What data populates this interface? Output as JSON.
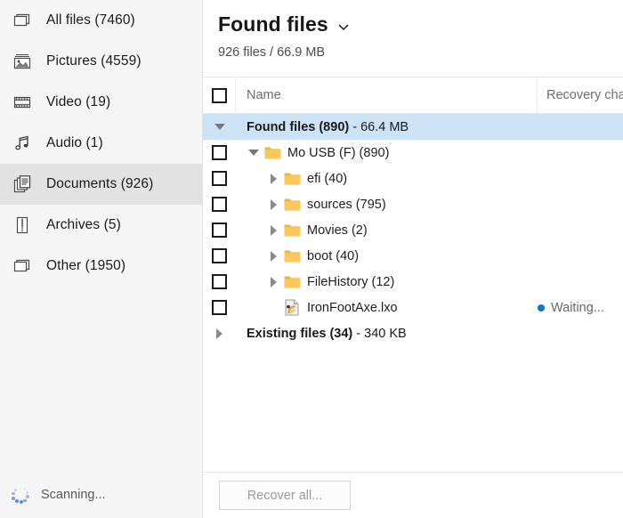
{
  "sidebar": {
    "items": [
      {
        "label": "All files (7460)",
        "icon": "window-icon",
        "selected": false
      },
      {
        "label": "Pictures (4559)",
        "icon": "picture-icon",
        "selected": false
      },
      {
        "label": "Video (19)",
        "icon": "film-icon",
        "selected": false
      },
      {
        "label": "Audio (1)",
        "icon": "music-note-icon",
        "selected": false
      },
      {
        "label": "Documents (926)",
        "icon": "documents-icon",
        "selected": true
      },
      {
        "label": "Archives (5)",
        "icon": "archive-icon",
        "selected": false
      },
      {
        "label": "Other (1950)",
        "icon": "window-icon",
        "selected": false
      }
    ],
    "status": {
      "text": "Scanning...",
      "icon": "loading-spinner-icon"
    }
  },
  "main": {
    "title": "Found files",
    "title_chevron": "chevron-down-icon",
    "subtitle": "926 files / 66.9 MB",
    "columns": {
      "select_all": "",
      "name": "Name",
      "recovery_chance": "Recovery chan"
    },
    "rows": [
      {
        "kind": "group",
        "selected": true,
        "expander": "triangle-down",
        "checkbox": false,
        "indent": 0,
        "label_bold": "Found files (890)",
        "label_rest": " - 66.4 MB",
        "status": ""
      },
      {
        "kind": "folder",
        "selected": false,
        "expander": "triangle-down",
        "checkbox": true,
        "indent": 1,
        "label": "Mo USB (F) (890)",
        "status": ""
      },
      {
        "kind": "folder",
        "selected": false,
        "expander": "triangle-right",
        "checkbox": true,
        "indent": 2,
        "label": "efi (40)",
        "status": ""
      },
      {
        "kind": "folder",
        "selected": false,
        "expander": "triangle-right",
        "checkbox": true,
        "indent": 2,
        "label": "sources (795)",
        "status": ""
      },
      {
        "kind": "folder",
        "selected": false,
        "expander": "triangle-right",
        "checkbox": true,
        "indent": 2,
        "label": "Movies (2)",
        "status": ""
      },
      {
        "kind": "folder",
        "selected": false,
        "expander": "triangle-right",
        "checkbox": true,
        "indent": 2,
        "label": "boot (40)",
        "status": ""
      },
      {
        "kind": "folder",
        "selected": false,
        "expander": "triangle-right",
        "checkbox": true,
        "indent": 2,
        "label": "FileHistory (12)",
        "status": ""
      },
      {
        "kind": "file",
        "selected": false,
        "expander": "none",
        "checkbox": true,
        "indent": 2,
        "label": "IronFootAxe.lxo",
        "status": "Waiting...",
        "status_dot": "#0b75d0"
      },
      {
        "kind": "group",
        "selected": false,
        "expander": "triangle-right",
        "checkbox": false,
        "indent": 0,
        "label_bold": "Existing files (34)",
        "label_rest": " - 340 KB",
        "status": ""
      }
    ],
    "footer": {
      "recover_all_label": "Recover all...",
      "recover_all_disabled": true
    }
  },
  "colors": {
    "selection_blue": "#cce3f6",
    "sidebar_bg": "#f5f5f5",
    "sidebar_selected": "#e2e2e2",
    "folder_yellow": "#fcc75b",
    "status_dot_blue": "#0b75d0",
    "spinner_blue": "#5b8ddb"
  }
}
